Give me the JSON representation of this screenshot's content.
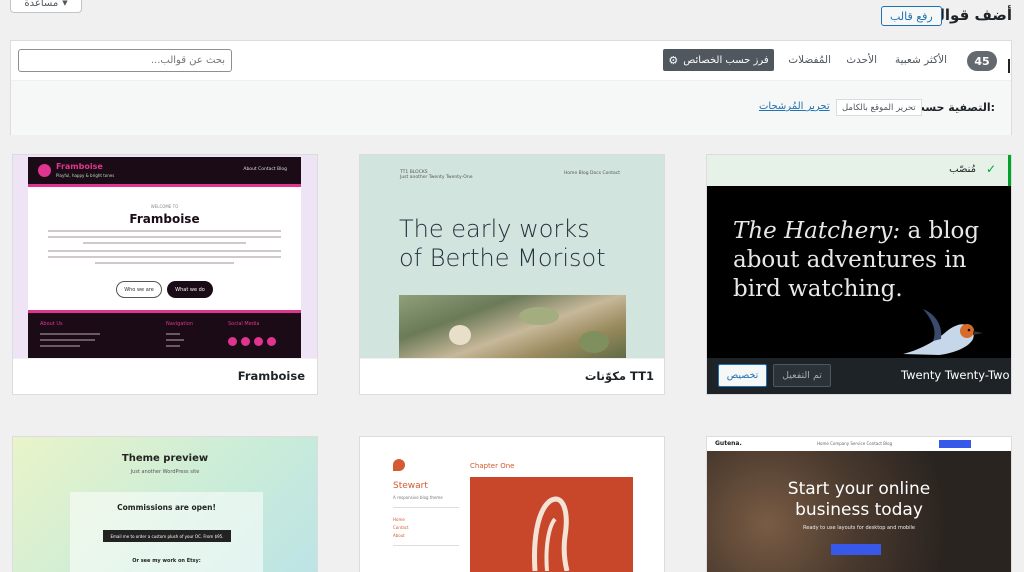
{
  "header": {
    "title": "أضف قوالب",
    "upload_button": "رفع قالب",
    "help_tab": "مساعدة"
  },
  "filter_bar": {
    "count": "45",
    "tabs": [
      {
        "label": "الأكثر شعبية"
      },
      {
        "label": "الأحدث"
      },
      {
        "label": "المُفضلات"
      }
    ],
    "feature_filter_button": "فرز حسب الخصائص",
    "search_placeholder": "بحث عن قوالب...",
    "filter_by_label": "التصفية حسب:",
    "active_filter": "تحرير الموقع بالكامل",
    "edit_filters_link": "تحرير المُرشحات"
  },
  "themes": [
    {
      "name": "Twenty Twenty-Two",
      "installed_label": "مُنصّب",
      "activated_button": "تم التفعيل",
      "customize_button": "تخصيص",
      "preview": {
        "heading_italic": "The Hatchery:",
        "heading_rest": " a blog about adventures in bird watching."
      }
    },
    {
      "name": "مكوّنات TT1",
      "preview": {
        "heading": "The early works of Berthe Morisot",
        "brand": "TT1 BLOCKS",
        "tagline": "Just another Twenty Twenty-One",
        "nav": "Home    Blog    Docs    Contact"
      }
    },
    {
      "name": "Framboise",
      "preview": {
        "logo": "Framboise",
        "tagline": "Playful, happy & bright tones",
        "nav": "About   Contact   Blog",
        "welcome": "WELCOME TO",
        "title": "Framboise",
        "button_primary": "Who we are",
        "button_secondary": "What we do",
        "footer_about": "About Us",
        "footer_nav": "Navigation",
        "footer_social": "Social Media"
      }
    },
    {
      "name": "Gutena",
      "preview": {
        "logo": "Gutena.",
        "nav": "Home   Company   Service   Contact   Blog",
        "heading": "Start your online business today",
        "sub": "Ready to use layouts for desktop and mobile"
      }
    },
    {
      "name": "Stewart",
      "preview": {
        "brand": "Stewart",
        "tagline": "A responsive blog theme",
        "chapter": "Chapter One",
        "links": [
          "Home",
          "Contact",
          "About"
        ]
      }
    },
    {
      "name": "Theme preview",
      "preview": {
        "title": "Theme preview",
        "subtitle": "Just another WordPress site",
        "commissions": "Commissions are open!",
        "email_text": "Email me to order a custom plush of your OC. From $95.",
        "etsy": "Or see my work on Etsy:"
      }
    }
  ],
  "colors": {
    "accent": "#2271b1",
    "active": "#00a32a",
    "badge": "#646970"
  }
}
